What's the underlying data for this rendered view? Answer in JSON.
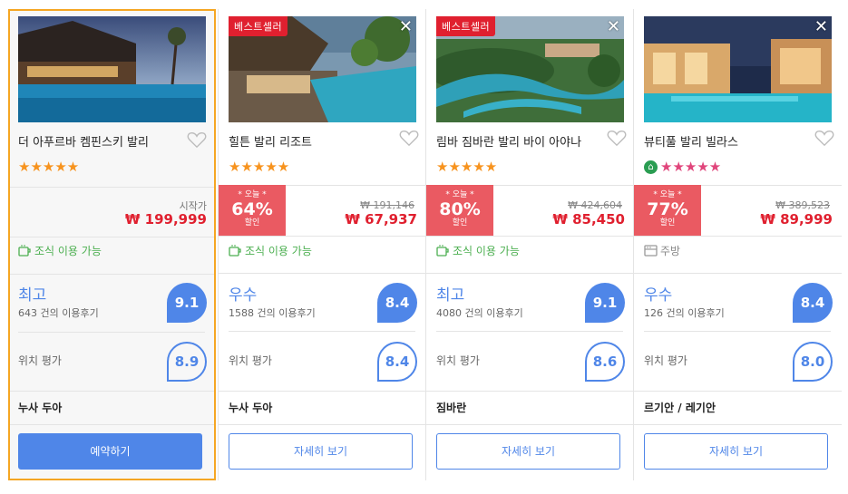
{
  "labels": {
    "bestseller": "베스트셀러",
    "from": "시작가",
    "today": "* 오늘 *",
    "sale": "할인",
    "location_rating": "위치 평가"
  },
  "hotels": [
    {
      "name": "더 아푸르바 켐핀스키 발리",
      "stars": "★★★★★",
      "price": "₩ 199,999",
      "feature": "조식 이용 가능",
      "rating_word": "최고",
      "reviews": "643 건의 이용후기",
      "score": "9.1",
      "location_score": "8.9",
      "area": "누사 두아",
      "button": "예약하기"
    },
    {
      "name": "힐튼 발리 리조트",
      "stars": "★★★★★",
      "discount": "64%",
      "old_price": "₩ 191,146",
      "price": "₩ 67,937",
      "feature": "조식 이용 가능",
      "rating_word": "우수",
      "reviews": "1588 건의 이용후기",
      "score": "8.4",
      "location_score": "8.4",
      "area": "누사 두아",
      "button": "자세히 보기"
    },
    {
      "name": "림바 짐바란 발리 바이 아야나",
      "stars": "★★★★★",
      "discount": "80%",
      "old_price": "₩ 424,604",
      "price": "₩ 85,450",
      "feature": "조식 이용 가능",
      "rating_word": "최고",
      "reviews": "4080 건의 이용후기",
      "score": "9.1",
      "location_score": "8.6",
      "area": "짐바란",
      "button": "자세히 보기"
    },
    {
      "name": "뷰티풀 발리 빌라스",
      "stars": "★★★★★",
      "discount": "77%",
      "old_price": "₩ 389,523",
      "price": "₩ 89,999",
      "feature": "주방",
      "rating_word": "우수",
      "reviews": "126 건의 이용후기",
      "score": "8.4",
      "location_score": "8.0",
      "area": "르기안 / 레기안",
      "button": "자세히 보기"
    }
  ],
  "colors": {
    "accent": "#4f86e8",
    "selected_border": "#f5a623",
    "price": "#e0202f",
    "discount_bg": "#ea5a62",
    "feature_green": "#4caf50"
  },
  "icons": {
    "heart": "heart-outline-icon",
    "close": "close-icon",
    "breakfast": "coffee-cup-icon",
    "kitchen": "stove-icon",
    "home": "home-icon"
  }
}
